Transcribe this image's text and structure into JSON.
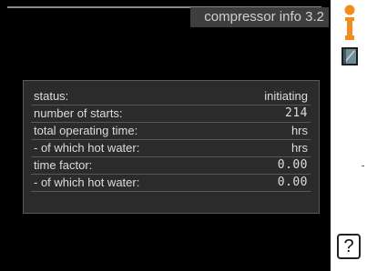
{
  "header": {
    "title": "compressor info 3.2"
  },
  "info_table": {
    "rows": [
      {
        "label": "status:",
        "value": "initiating"
      },
      {
        "label": "number of starts:",
        "value": "214"
      },
      {
        "label": "total operating time:",
        "value": "hrs"
      },
      {
        "label": "- of which hot water:",
        "value": "hrs"
      },
      {
        "label": "time factor:",
        "value": "0.00"
      },
      {
        "label": "- of which hot water:",
        "value": "0.00"
      }
    ]
  },
  "sidebar": {
    "info_icon": "info-icon",
    "book_icon": "book-icon",
    "help_label": "?"
  },
  "colors": {
    "screen_background": "#000000",
    "panel_background": "#2b2b2b",
    "accent_orange": "#f28a1e",
    "text": "#dcdcdc"
  }
}
